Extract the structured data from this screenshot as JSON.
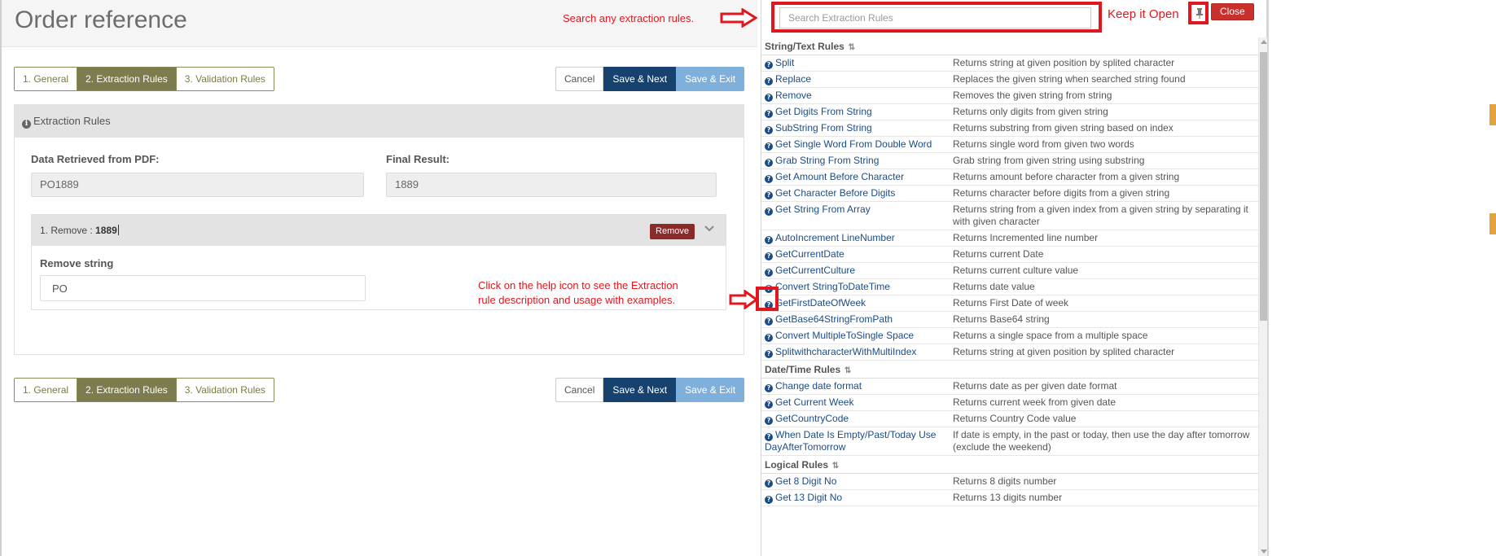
{
  "page": {
    "title": "Order reference"
  },
  "tabs": [
    {
      "label": "1. General"
    },
    {
      "label": "2. Extraction Rules"
    },
    {
      "label": "3. Validation Rules"
    }
  ],
  "actions": {
    "cancel": "Cancel",
    "save_next": "Save & Next",
    "save_exit": "Save & Exit"
  },
  "panel": {
    "header": "Extraction Rules",
    "data_label": "Data Retrieved from PDF:",
    "data_value": "PO1889",
    "final_label": "Final Result:",
    "final_value": "1889",
    "rule_prefix": "1. Remove :",
    "rule_value": "1889",
    "remove_button": "Remove",
    "remove_string_label": "Remove string",
    "remove_string_value": "PO"
  },
  "annotations": {
    "search_note": "Search any extraction rules.",
    "help_note_line1": "Click on the help icon to see the Extraction",
    "help_note_line2": "rule description and usage with examples.",
    "keep_open": "Keep it Open"
  },
  "side_panel": {
    "search_placeholder": "Search Extraction Rules",
    "close": "Close",
    "groups": [
      {
        "title": "String/Text Rules",
        "rules": [
          {
            "name": "Split",
            "desc": "Returns string at given position by splited character"
          },
          {
            "name": "Replace",
            "desc": "Replaces the given string when searched string found"
          },
          {
            "name": "Remove",
            "desc": "Removes the given string from string"
          },
          {
            "name": "Get Digits From String",
            "desc": "Returns only digits from given string"
          },
          {
            "name": "SubString From String",
            "desc": "Returns substring from given string based on index"
          },
          {
            "name": "Get Single Word From Double Word",
            "desc": "Returns single word from given two words"
          },
          {
            "name": "Grab String From String",
            "desc": "Grab string from given string using substring"
          },
          {
            "name": "Get Amount Before Character",
            "desc": "Returns amount before character from a given string"
          },
          {
            "name": "Get Character Before Digits",
            "desc": "Returns character before digits from a given string"
          },
          {
            "name": "Get String From Array",
            "desc": "Returns string from a given index from a given string by separating it with given character"
          },
          {
            "name": "AutoIncrement LineNumber",
            "desc": "Returns Incremented line number"
          },
          {
            "name": "GetCurrentDate",
            "desc": "Returns current Date"
          },
          {
            "name": "GetCurrentCulture",
            "desc": "Returns current culture value"
          },
          {
            "name": "Convert StringToDateTime",
            "desc": "Returns date value"
          },
          {
            "name": "GetFirstDateOfWeek",
            "desc": "Returns First Date of week"
          },
          {
            "name": "GetBase64StringFromPath",
            "desc": "Returns Base64 string"
          },
          {
            "name": "Convert MultipleToSingle Space",
            "desc": "Returns a single space from a multiple space"
          },
          {
            "name": "SplitwithcharacterWithMultiIndex",
            "desc": "Returns string at given position by splited character"
          }
        ]
      },
      {
        "title": "Date/Time Rules",
        "rules": [
          {
            "name": "Change date format",
            "desc": "Returns date as per given date format"
          },
          {
            "name": "Get Current Week",
            "desc": "Returns current week from given date"
          },
          {
            "name": "GetCountryCode",
            "desc": "Returns Country Code value"
          },
          {
            "name": "When Date Is Empty/Past/Today Use DayAfterTomorrow",
            "desc": "If date is empty, in the past or today, then use the day after tomorrow (exclude the weekend)"
          }
        ]
      },
      {
        "title": "Logical Rules",
        "rules": [
          {
            "name": "Get 8 Digit No",
            "desc": "Returns 8 digits number"
          },
          {
            "name": "Get 13 Digit No",
            "desc": "Returns 13 digits number"
          }
        ]
      }
    ]
  },
  "colors": {
    "accent_olive": "#7c7c4e",
    "save_next": "#17416e",
    "save_exit": "#7fb0dc",
    "remove": "#8b2a2a",
    "annotation_red": "#e0171f",
    "link_blue": "#1a4c86"
  }
}
